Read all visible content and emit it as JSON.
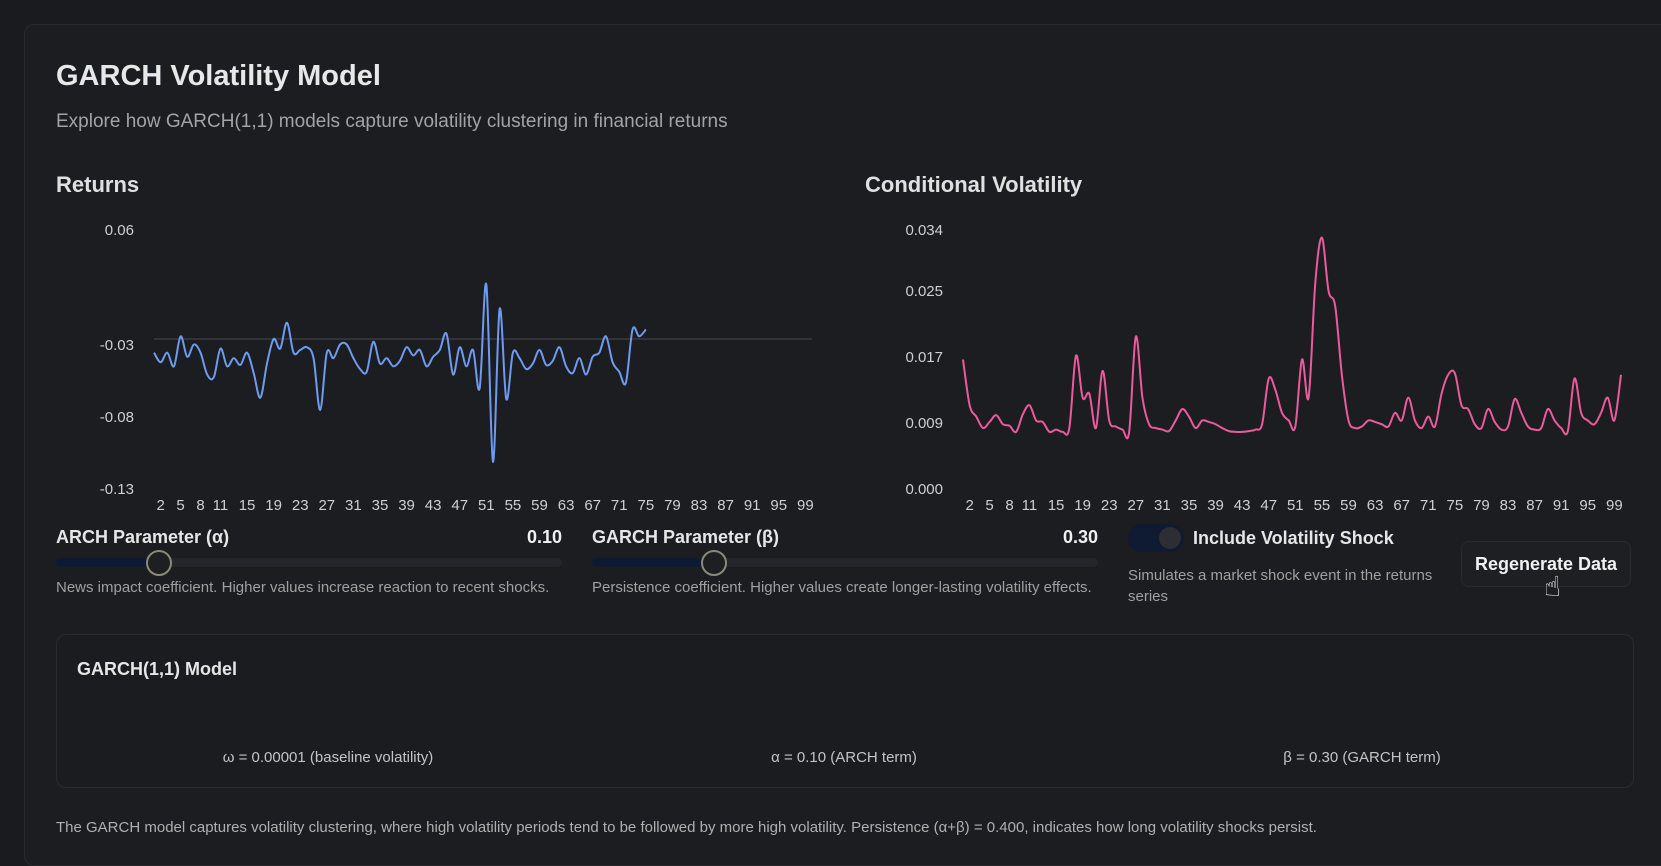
{
  "header": {
    "title": "GARCH Volatility Model",
    "subtitle": "Explore how GARCH(1,1) models capture volatility clustering in financial returns"
  },
  "colors": {
    "returns_line": "#6e9bf0",
    "volatility_line": "#ec5a9e",
    "background": "#1a1b1e"
  },
  "chart_data": [
    {
      "type": "line",
      "title": "Returns",
      "ylim": [
        -0.13,
        0.06
      ],
      "y_ticks": [
        "0.06",
        "-0.03",
        "-0.08",
        "-0.13"
      ],
      "x_ticks": [
        "2",
        "5",
        "8",
        "11",
        "15",
        "19",
        "23",
        "27",
        "31",
        "35",
        "39",
        "43",
        "47",
        "51",
        "55",
        "59",
        "63",
        "67",
        "71",
        "75",
        "79",
        "83",
        "87",
        "91",
        "95",
        "99"
      ],
      "reference_line_y": -0.02,
      "x": [
        1,
        2,
        3,
        4,
        5,
        6,
        7,
        8,
        9,
        10,
        11,
        12,
        13,
        14,
        15,
        16,
        17,
        18,
        19,
        20,
        21,
        22,
        23,
        24,
        25,
        26,
        27,
        28,
        29,
        30,
        31,
        32,
        33,
        34,
        35,
        36,
        37,
        38,
        39,
        40,
        41,
        42,
        43,
        44,
        45,
        46,
        47,
        48,
        49,
        50,
        51,
        52,
        53,
        54,
        55,
        56,
        57,
        58,
        59,
        60,
        61,
        62,
        63,
        64,
        65,
        66,
        67,
        68,
        69,
        70,
        71,
        72,
        73,
        74,
        75
      ],
      "values": [
        -0.03,
        -0.037,
        -0.03,
        -0.04,
        -0.018,
        -0.033,
        -0.024,
        -0.03,
        -0.046,
        -0.048,
        -0.027,
        -0.04,
        -0.034,
        -0.039,
        -0.03,
        -0.045,
        -0.063,
        -0.038,
        -0.02,
        -0.027,
        -0.008,
        -0.03,
        -0.028,
        -0.026,
        -0.034,
        -0.072,
        -0.03,
        -0.034,
        -0.024,
        -0.024,
        -0.034,
        -0.042,
        -0.044,
        -0.022,
        -0.038,
        -0.034,
        -0.04,
        -0.036,
        -0.026,
        -0.032,
        -0.028,
        -0.04,
        -0.033,
        -0.028,
        -0.016,
        -0.046,
        -0.026,
        -0.04,
        -0.028,
        -0.056,
        0.02,
        -0.11,
        0.002,
        -0.064,
        -0.03,
        -0.034,
        -0.042,
        -0.038,
        -0.028,
        -0.039,
        -0.036,
        -0.026,
        -0.04,
        -0.045,
        -0.034,
        -0.046,
        -0.033,
        -0.03,
        -0.018,
        -0.037,
        -0.044,
        -0.052,
        -0.013,
        -0.018,
        -0.013
      ]
    },
    {
      "type": "line",
      "title": "Conditional Volatility",
      "ylim": [
        0,
        0.034
      ],
      "y_ticks": [
        "0.034",
        "0.025",
        "0.017",
        "0.009",
        "0.000"
      ],
      "x_ticks": [
        "2",
        "5",
        "8",
        "11",
        "15",
        "19",
        "23",
        "27",
        "31",
        "35",
        "39",
        "43",
        "47",
        "51",
        "55",
        "59",
        "63",
        "67",
        "71",
        "75",
        "79",
        "83",
        "87",
        "91",
        "95",
        "99"
      ],
      "x": [
        1,
        2,
        3,
        4,
        5,
        6,
        7,
        8,
        9,
        10,
        11,
        12,
        13,
        14,
        15,
        16,
        17,
        18,
        19,
        20,
        21,
        22,
        23,
        24,
        25,
        26,
        27,
        28,
        29,
        30,
        31,
        32,
        33,
        34,
        35,
        36,
        37,
        38,
        39,
        40,
        41,
        42,
        43,
        44,
        45,
        46,
        47,
        48,
        49,
        50,
        51,
        52,
        53,
        54,
        55,
        56,
        57,
        58,
        59,
        60,
        61,
        62,
        63,
        64,
        65,
        66,
        67,
        68,
        69,
        70,
        71,
        72,
        73,
        74,
        75,
        76,
        77,
        78,
        79,
        80,
        81,
        82,
        83,
        84,
        85,
        86,
        87,
        88,
        89,
        90,
        91,
        92,
        93,
        94,
        95,
        96,
        97,
        98,
        99,
        100
      ],
      "values": [
        0.017,
        0.011,
        0.0095,
        0.008,
        0.0088,
        0.0097,
        0.0085,
        0.0083,
        0.0075,
        0.0098,
        0.011,
        0.009,
        0.0088,
        0.0075,
        0.0078,
        0.0075,
        0.008,
        0.0175,
        0.012,
        0.0125,
        0.008,
        0.0155,
        0.009,
        0.0082,
        0.0078,
        0.0075,
        0.02,
        0.012,
        0.0085,
        0.008,
        0.0078,
        0.0076,
        0.009,
        0.0105,
        0.0095,
        0.008,
        0.009,
        0.0088,
        0.0085,
        0.008,
        0.0076,
        0.0075,
        0.0075,
        0.0076,
        0.0078,
        0.0085,
        0.0145,
        0.013,
        0.01,
        0.009,
        0.0082,
        0.017,
        0.012,
        0.027,
        0.033,
        0.026,
        0.024,
        0.015,
        0.009,
        0.008,
        0.0082,
        0.009,
        0.0088,
        0.0085,
        0.0082,
        0.01,
        0.009,
        0.012,
        0.009,
        0.008,
        0.0095,
        0.0082,
        0.0125,
        0.015,
        0.0152,
        0.011,
        0.0105,
        0.0085,
        0.008,
        0.0105,
        0.0088,
        0.0078,
        0.0082,
        0.0118,
        0.01,
        0.0082,
        0.0078,
        0.008,
        0.0105,
        0.009,
        0.008,
        0.0076,
        0.0145,
        0.01,
        0.009,
        0.0085,
        0.01,
        0.012,
        0.009,
        0.015,
        0.011
      ]
    }
  ],
  "controls": {
    "alpha": {
      "label": "ARCH Parameter (α)",
      "value": "0.10",
      "fraction": 0.2,
      "description": "News impact coefficient. Higher values increase reaction to recent shocks."
    },
    "beta": {
      "label": "GARCH Parameter (β)",
      "value": "0.30",
      "fraction": 0.238,
      "description": "Persistence coefficient. Higher values create longer-lasting volatility effects."
    },
    "shock": {
      "label": "Include Volatility Shock",
      "checked": true,
      "description": "Simulates a market shock event in the returns series"
    },
    "regenerate_label": "Regenerate Data"
  },
  "model": {
    "title": "GARCH(1,1) Model",
    "omega": "ω = 0.00001 (baseline volatility)",
    "alpha": "α = 0.10 (ARCH term)",
    "beta": "β = 0.30 (GARCH term)"
  },
  "footnote": "The GARCH model captures volatility clustering, where high volatility periods tend to be followed by more high volatility. Persistence (α+β) = 0.400, indicates how long volatility shocks persist."
}
